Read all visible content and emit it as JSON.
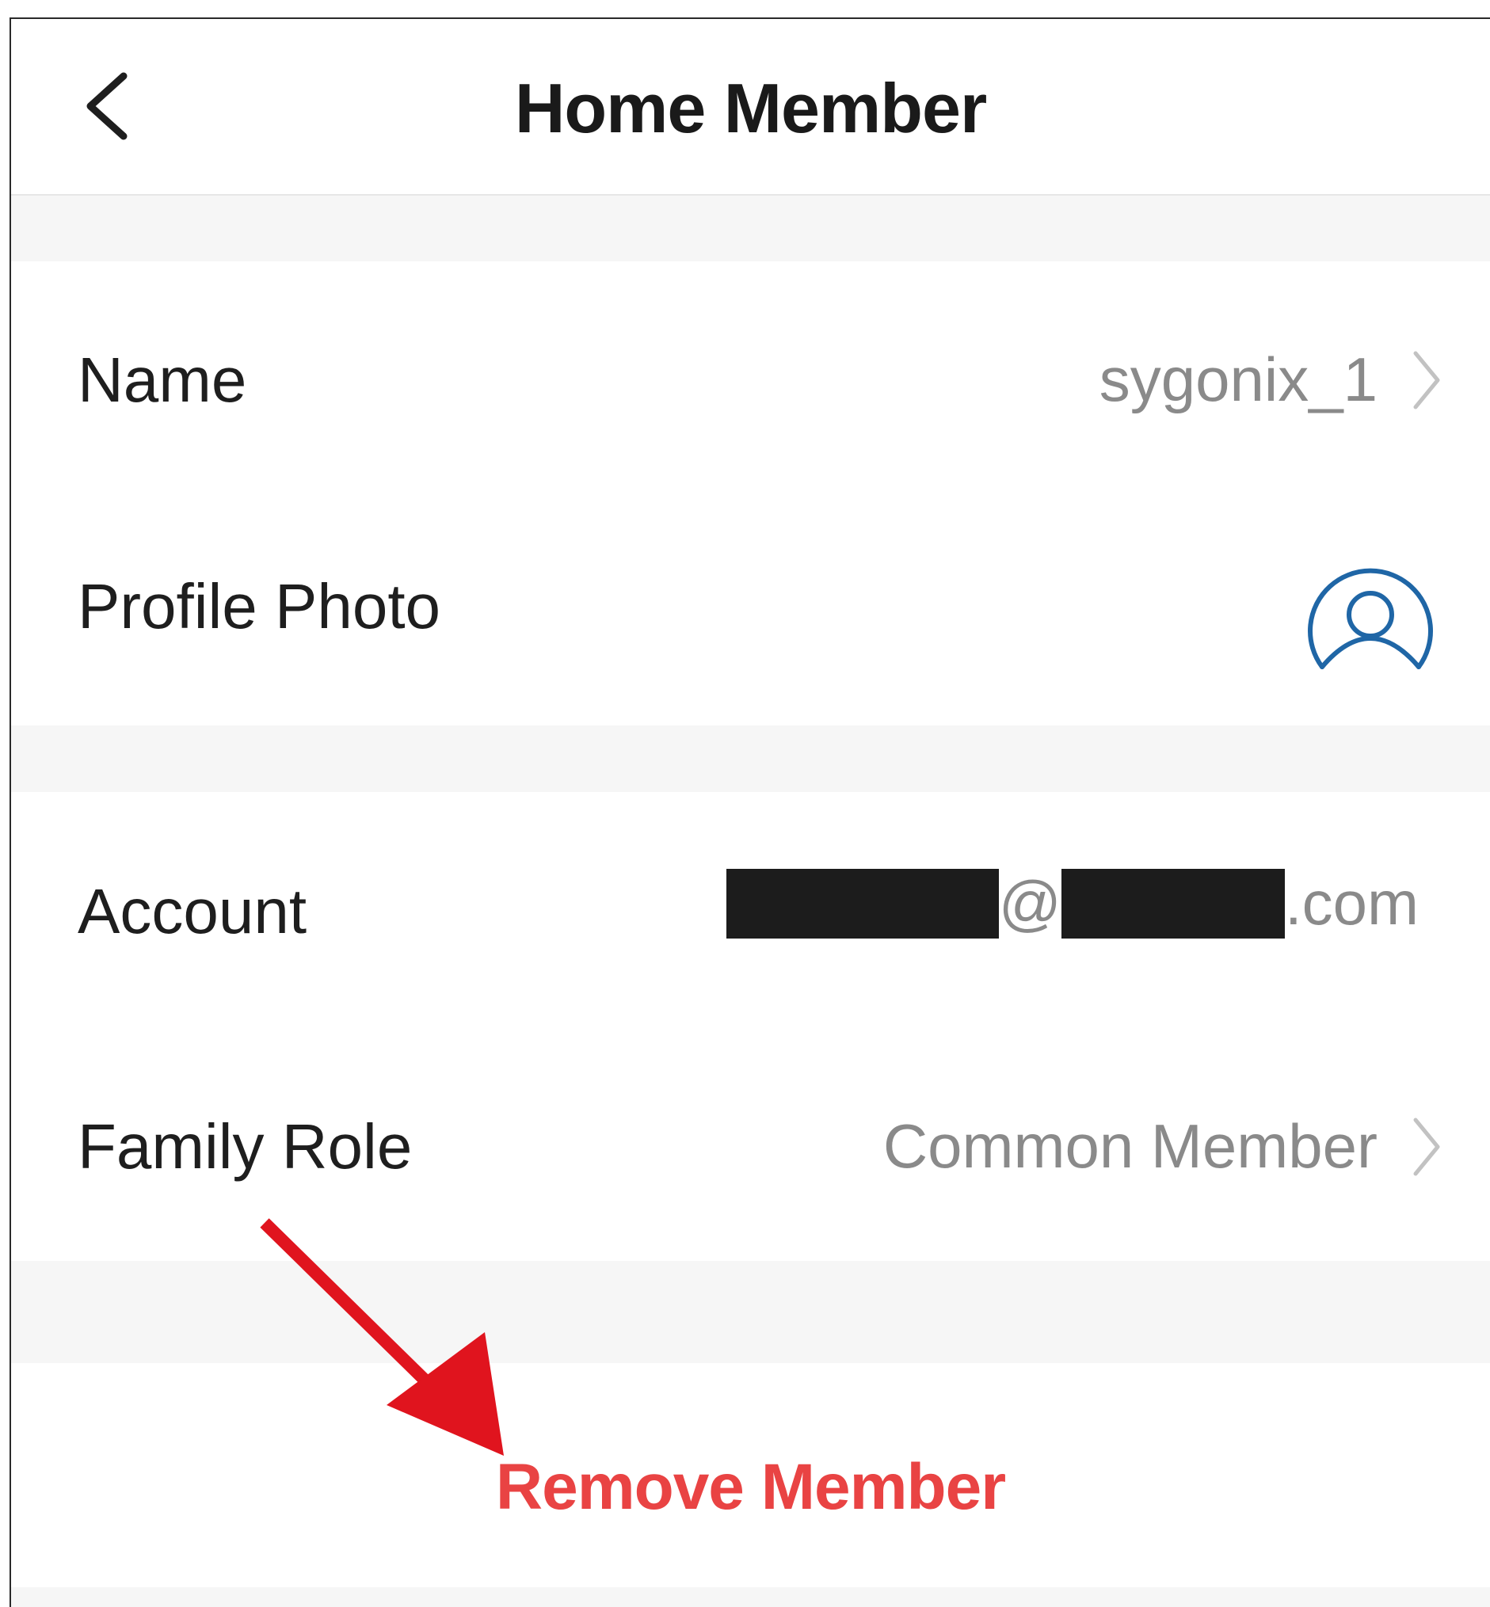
{
  "header": {
    "title": "Home Member"
  },
  "rows": {
    "name": {
      "label": "Name",
      "value": "sygonix_1"
    },
    "profile_photo": {
      "label": "Profile Photo"
    },
    "account": {
      "label": "Account",
      "at": "@",
      "suffix": ".com"
    },
    "family_role": {
      "label": "Family Role",
      "value": "Common Member"
    }
  },
  "actions": {
    "remove_label": "Remove Member"
  },
  "colors": {
    "remove_red": "#e94343",
    "avatar_blue": "#1f66a6",
    "annotation_arrow": "#e0141e"
  },
  "icons": {
    "back": "chevron-left-icon",
    "chevron": "chevron-right-icon",
    "avatar": "user-avatar-icon",
    "annotation": "red-pointer-arrow-icon"
  }
}
